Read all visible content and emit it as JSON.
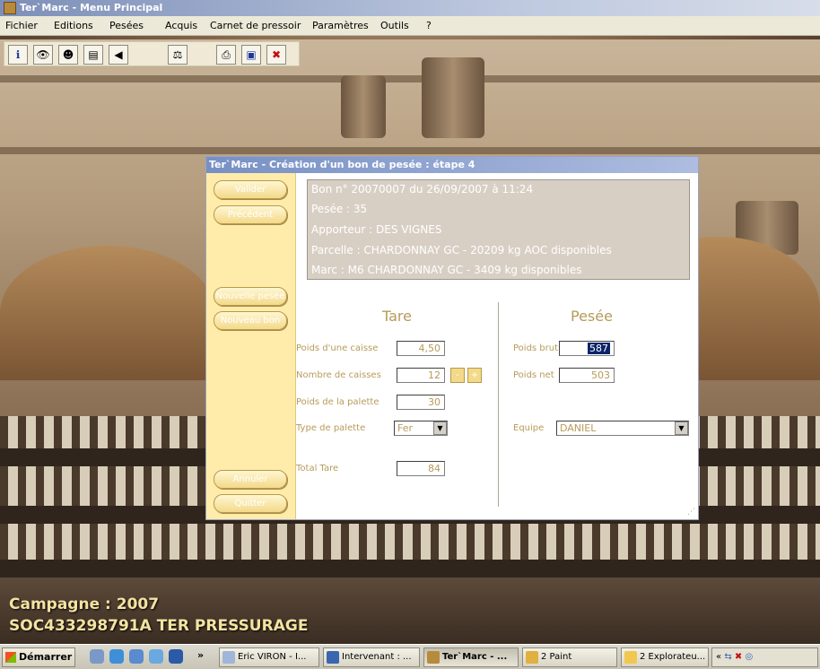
{
  "window": {
    "title": "Ter`Marc - Menu Principal"
  },
  "menu": [
    "Fichier",
    "Editions",
    "Pesées",
    "Acquis",
    "Carnet de pressoir",
    "Paramètres",
    "Outils",
    "?"
  ],
  "toolbar": {
    "icons": [
      "info-icon",
      "binoculars-icon",
      "person-icon",
      "press-icon",
      "back-icon",
      "scale-icon",
      "print-icon",
      "save-icon",
      "exit-icon"
    ]
  },
  "background": {
    "campaign": "Campagne : 2007",
    "company": "SOC433298791A TER PRESSURAGE"
  },
  "dialog": {
    "title": "Ter`Marc - Création d'un bon de pesée : étape 4",
    "buttons": {
      "validate": "Valider",
      "previous": "Précédent",
      "new_weighing": "Nouvelle pesée",
      "new_receipt": "Nouveau bon",
      "cancel": "Annuler",
      "quit": "Quitter"
    },
    "info": {
      "line1": "Bon n° 20070007 du 26/09/2007 à 11:24",
      "line2": "Pesée : 35",
      "line3": "Apporteur : DES VIGNES",
      "line4": "Parcelle : CHARDONNAY GC - 20209 kg AOC disponibles",
      "line5": "Marc : M6 CHARDONNAY GC - 3409 kg disponibles"
    },
    "tare": {
      "title": "Tare",
      "crate_weight_label": "Poids d'une caisse",
      "crate_weight": "4,50",
      "crate_count_label": "Nombre de caisses",
      "crate_count": "12",
      "minus": "-",
      "plus": "+",
      "pallet_weight_label": "Poids de la palette",
      "pallet_weight": "30",
      "pallet_type_label": "Type de palette",
      "pallet_type": "Fer",
      "total_label": "Total Tare",
      "total": "84"
    },
    "weighing": {
      "title": "Pesée",
      "gross_label": "Poids brut",
      "gross": "587",
      "net_label": "Poids net",
      "net": "503",
      "team_label": "Equipe",
      "team": "DANIEL"
    }
  },
  "taskbar": {
    "start": "Démarrer",
    "overflow": "»",
    "tasks": [
      "Eric VIRON - I...",
      "Intervenant : ...",
      "Ter`Marc - ...",
      "2 Paint",
      "2 Explorateu..."
    ],
    "tray": "«"
  }
}
